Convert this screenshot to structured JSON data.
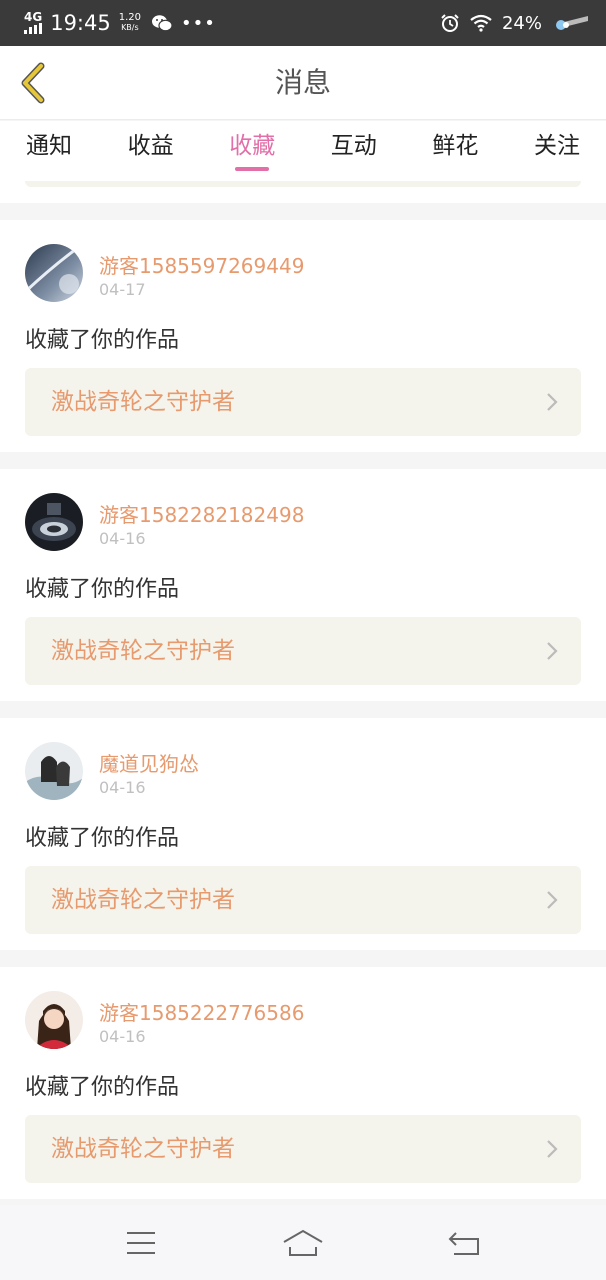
{
  "status_bar": {
    "network": "4G",
    "time": "19:45",
    "speed_value": "1.20",
    "speed_unit": "KB/s",
    "battery": "24%",
    "icons": [
      "signal-icon",
      "wechat-icon",
      "more-dots-icon",
      "alarm-icon",
      "wifi-icon",
      "weather-icon"
    ]
  },
  "header": {
    "title": "消息",
    "back_icon": "chevron-left-icon"
  },
  "tabs": [
    {
      "label": "通知",
      "active": false
    },
    {
      "label": "收益",
      "active": false
    },
    {
      "label": "收藏",
      "active": true
    },
    {
      "label": "互动",
      "active": false
    },
    {
      "label": "鲜花",
      "active": false
    },
    {
      "label": "关注",
      "active": false
    }
  ],
  "messages": [
    {
      "user": "游客1585597269449",
      "date": "04-17",
      "action": "收藏了你的作品",
      "work": "激战奇轮之守护者",
      "avatar_icon": "avatar-sky-icon"
    },
    {
      "user": "游客1582282182498",
      "date": "04-16",
      "action": "收藏了你的作品",
      "work": "激战奇轮之守护者",
      "avatar_icon": "avatar-dark-icon"
    },
    {
      "user": "魔道见狗怂",
      "date": "04-16",
      "action": "收藏了你的作品",
      "work": "激战奇轮之守护者",
      "avatar_icon": "avatar-anime-icon"
    },
    {
      "user": "游客1585222776586",
      "date": "04-16",
      "action": "收藏了你的作品",
      "work": "激战奇轮之守护者",
      "avatar_icon": "avatar-girl-icon"
    }
  ],
  "bottom_nav": {
    "icons": [
      "menu-icon",
      "home-icon",
      "back-icon"
    ]
  },
  "colors": {
    "accent_pink": "#e26fa8",
    "username_orange": "#e79a6e",
    "back_chevron_yellow": "#e6c73a",
    "link_bg": "#f4f4ec"
  }
}
